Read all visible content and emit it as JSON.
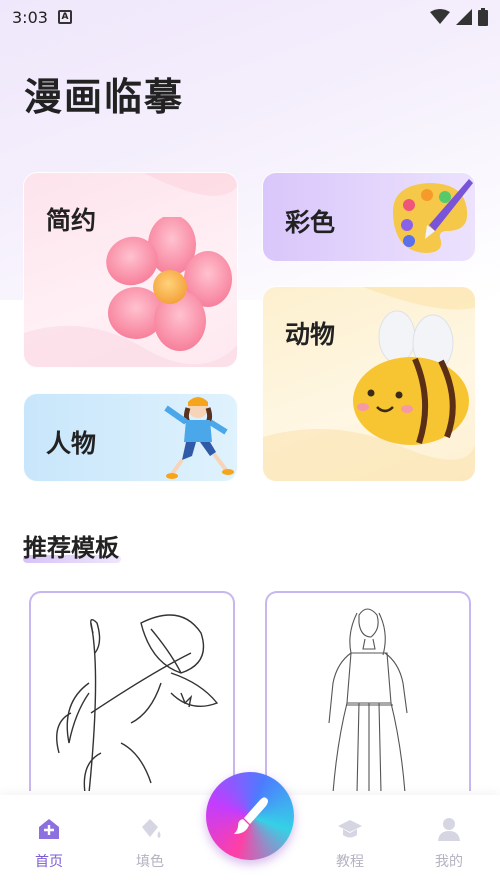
{
  "status_bar": {
    "time": "3:03",
    "notif_icon": "A"
  },
  "app": {
    "title": "漫画临摹"
  },
  "categories": [
    {
      "label": "简约"
    },
    {
      "label": "彩色"
    },
    {
      "label": "动物"
    },
    {
      "label": "人物"
    }
  ],
  "recommend": {
    "title": "推荐模板"
  },
  "nav": {
    "home": "首页",
    "fill": "填色",
    "course": "教程",
    "mine": "我的"
  },
  "colors": {
    "accent": "#7b5cd6",
    "inactive": "#b3b3c2"
  }
}
